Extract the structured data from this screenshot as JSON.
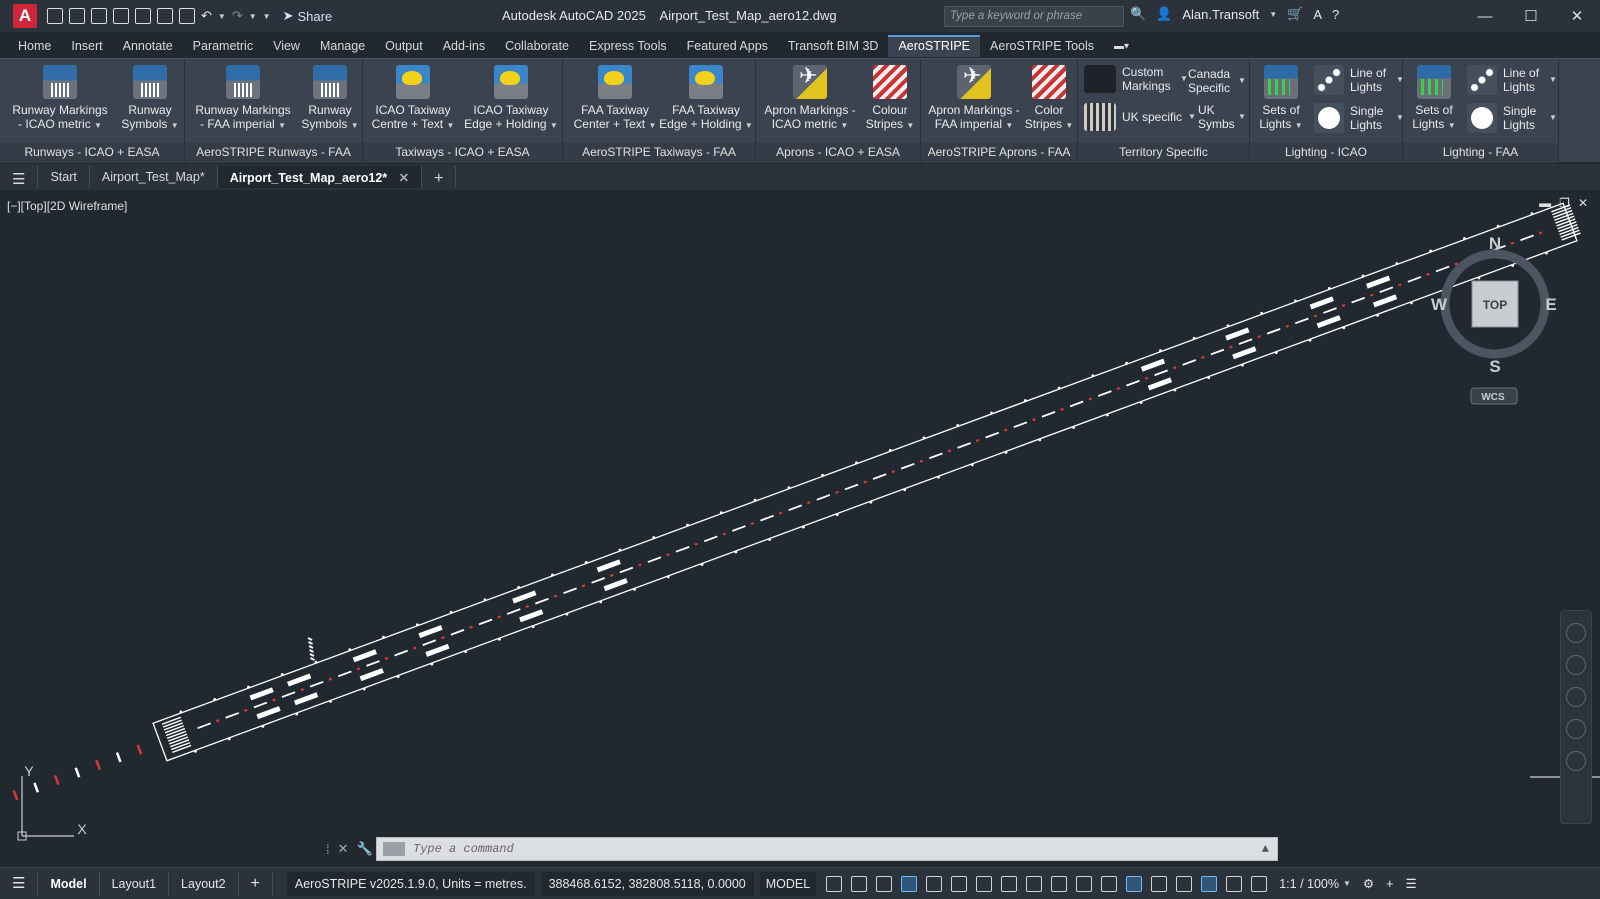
{
  "app": {
    "logo": "A",
    "title": "Autodesk AutoCAD 2025    Airport_Test_Map_aero12.dwg",
    "share": "Share",
    "search_placeholder": "Type a keyword or phrase",
    "user": "Alan.Transoft"
  },
  "menu_tabs": [
    "Home",
    "Insert",
    "Annotate",
    "Parametric",
    "View",
    "Manage",
    "Output",
    "Add-ins",
    "Collaborate",
    "Express Tools",
    "Featured Apps",
    "Transoft BIM 3D",
    "AeroSTRIPE",
    "AeroSTRIPE Tools"
  ],
  "active_menu_tab": "AeroSTRIPE",
  "ribbon": {
    "panels": [
      {
        "title": "Runways - ICAO + EASA",
        "buttons": [
          "Runway Markings - ICAO metric",
          "Runway Symbols"
        ]
      },
      {
        "title": "AeroSTRIPE Runways - FAA",
        "buttons": [
          "Runway Markings - FAA imperial",
          "Runway Symbols"
        ]
      },
      {
        "title": "Taxiways - ICAO + EASA",
        "buttons": [
          "ICAO Taxiway Centre + Text",
          "ICAO Taxiway Edge + Holding"
        ]
      },
      {
        "title": "AeroSTRIPE Taxiways - FAA",
        "buttons": [
          "FAA Taxiway Center + Text",
          "FAA Taxiway Edge + Holding"
        ]
      },
      {
        "title": "Aprons - ICAO + EASA",
        "buttons": [
          "Apron Markings - ICAO metric",
          "Colour Stripes"
        ]
      },
      {
        "title": "AeroSTRIPE Aprons - FAA",
        "buttons": [
          "Apron Markings - FAA imperial",
          "Color Stripes"
        ]
      },
      {
        "title": "Territory Specific",
        "buttons": [
          "Custom Markings",
          "Canada Specific",
          "UK specific",
          "UK Symbs"
        ]
      },
      {
        "title": "Lighting - ICAO",
        "buttons": [
          "Sets of Lights",
          "Line of Lights",
          "Single Lights"
        ]
      },
      {
        "title": "Lighting - FAA",
        "buttons": [
          "Sets of Lights",
          "Line of Lights",
          "Single Lights"
        ]
      }
    ]
  },
  "doc_tabs": [
    "Start",
    "Airport_Test_Map*",
    "Airport_Test_Map_aero12*"
  ],
  "active_doc_tab": "Airport_Test_Map_aero12*",
  "viewport": {
    "label": "[−][Top][2D Wireframe]",
    "viewcube": {
      "top": "TOP",
      "n": "N",
      "s": "S",
      "e": "E",
      "w": "W",
      "wcs": "WCS"
    },
    "ucs": {
      "x": "X",
      "y": "Y"
    }
  },
  "command": {
    "placeholder": "Type a command"
  },
  "status": {
    "layout_tabs": [
      "Model",
      "Layout1",
      "Layout2"
    ],
    "active_layout": "Model",
    "plugin": "AeroSTRIPE v2025.1.9.0,  Units = metres.",
    "coords": "388468.6152, 382808.5118, 0.0000",
    "space": "MODEL",
    "scale": "1:1 / 100%"
  },
  "colors": {
    "background": "#212830",
    "ribbon": "#3b4350",
    "runway_line": "#ffffff",
    "centerline_red": "#d23a3a",
    "accent": "#d0263a"
  }
}
